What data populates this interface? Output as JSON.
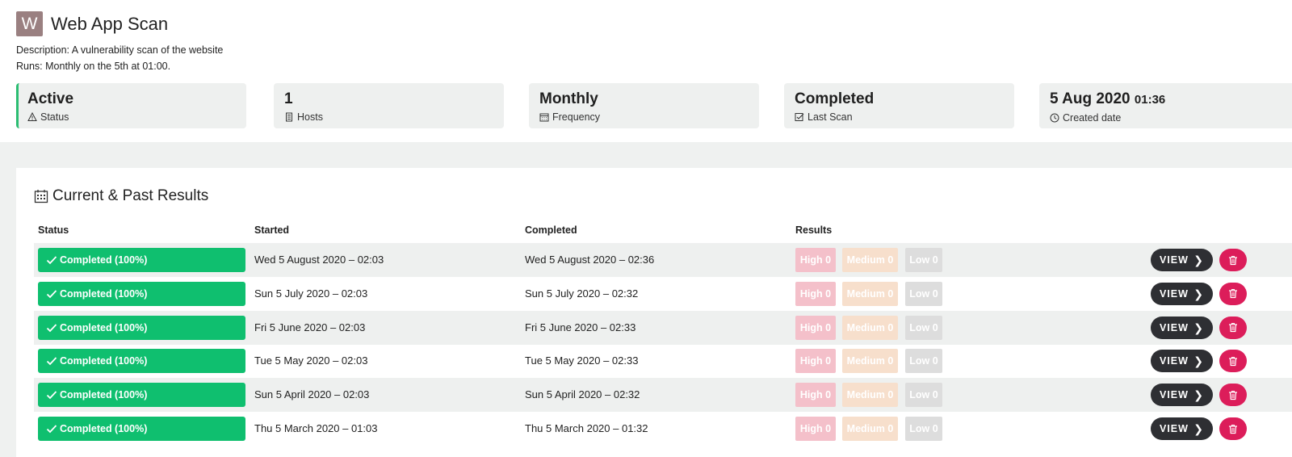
{
  "header": {
    "avatar_letter": "W",
    "title": "Web App Scan",
    "description": "Description: A vulnerability scan of the website",
    "runs": "Runs: Monthly on the 5th at 01:00."
  },
  "stats": [
    {
      "value": "Active",
      "label": "Status",
      "icon": "warning-icon"
    },
    {
      "value": "1",
      "label": "Hosts",
      "icon": "server-icon"
    },
    {
      "value": "Monthly",
      "label": "Frequency",
      "icon": "calendar-icon"
    },
    {
      "value": "Completed",
      "label": "Last Scan",
      "icon": "check-square-icon"
    },
    {
      "value": "5 Aug 2020",
      "value_time": "01:36",
      "label": "Created date",
      "icon": "clock-icon"
    }
  ],
  "results": {
    "title": "Current & Past Results",
    "columns": [
      "Status",
      "Started",
      "Completed",
      "Results"
    ],
    "view_label": "VIEW",
    "rows": [
      {
        "status": "Completed (100%)",
        "started": "Wed 5 August 2020 – 02:03",
        "completed": "Wed 5 August 2020 – 02:36",
        "high": "High 0",
        "medium": "Medium 0",
        "low": "Low 0"
      },
      {
        "status": "Completed (100%)",
        "started": "Sun 5 July 2020 – 02:03",
        "completed": "Sun 5 July 2020 – 02:32",
        "high": "High 0",
        "medium": "Medium 0",
        "low": "Low 0"
      },
      {
        "status": "Completed (100%)",
        "started": "Fri 5 June 2020 – 02:03",
        "completed": "Fri 5 June 2020 – 02:33",
        "high": "High 0",
        "medium": "Medium 0",
        "low": "Low 0"
      },
      {
        "status": "Completed (100%)",
        "started": "Tue 5 May 2020 – 02:03",
        "completed": "Tue 5 May 2020 – 02:33",
        "high": "High 0",
        "medium": "Medium 0",
        "low": "Low 0"
      },
      {
        "status": "Completed (100%)",
        "started": "Sun 5 April 2020 – 02:03",
        "completed": "Sun 5 April 2020 – 02:32",
        "high": "High 0",
        "medium": "Medium 0",
        "low": "Low 0"
      },
      {
        "status": "Completed (100%)",
        "started": "Thu 5 March 2020 – 01:03",
        "completed": "Thu 5 March 2020 – 01:32",
        "high": "High 0",
        "medium": "Medium 0",
        "low": "Low 0"
      }
    ]
  },
  "colors": {
    "accent_green": "#0fbf6f",
    "active_border": "#2bbd72",
    "view_button": "#2e2f33",
    "delete_button": "#dc1d5a",
    "high_badge": "#f4c0ca",
    "medium_badge": "#f7dfcc",
    "low_badge": "#dddddd"
  }
}
